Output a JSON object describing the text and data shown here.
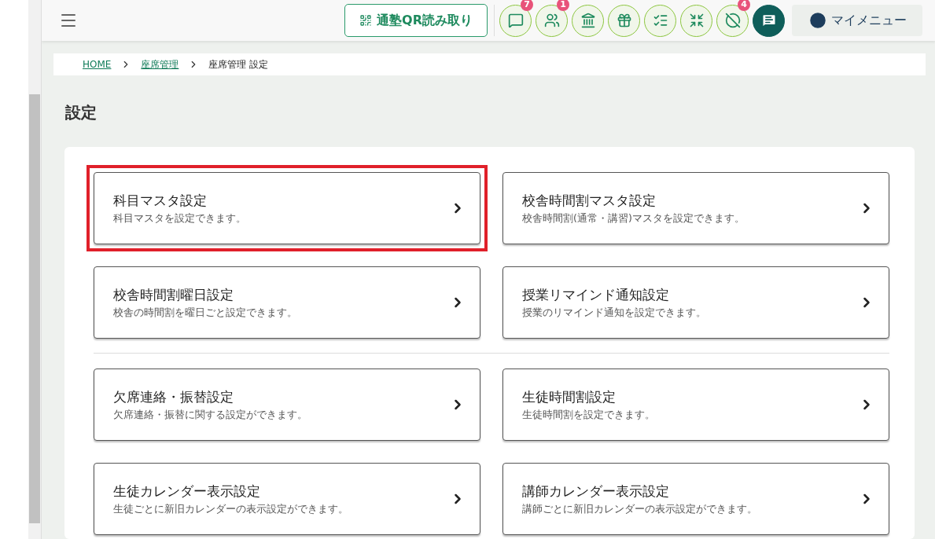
{
  "header": {
    "qr_button": "通塾QR読み取り",
    "icon_buttons": [
      {
        "kind": "chat",
        "badge": "7"
      },
      {
        "kind": "people",
        "badge": "1"
      },
      {
        "kind": "building"
      },
      {
        "kind": "gift"
      },
      {
        "kind": "checklist"
      },
      {
        "kind": "merge"
      },
      {
        "kind": "compass-off",
        "badge": "4"
      },
      {
        "kind": "message-filled"
      }
    ],
    "my_menu": "マイメニュー"
  },
  "breadcrumb": [
    {
      "label": "HOME",
      "link": true
    },
    {
      "label": "座席管理",
      "link": true
    },
    {
      "label": "座席管理 設定",
      "link": false
    }
  ],
  "page_title": "設定",
  "groups": [
    [
      {
        "title": "科目マスタ設定",
        "description": "科目マスタを設定できます。",
        "highlighted": true
      },
      {
        "title": "校舎時間割マスタ設定",
        "description": "校舎時間割(通常・講習)マスタを設定できます。",
        "highlighted": false
      },
      {
        "title": "校舎時間割曜日設定",
        "description": "校舎の時間割を曜日ごと設定できます。",
        "highlighted": false
      },
      {
        "title": "授業リマインド通知設定",
        "description": "授業のリマインド通知を設定できます。",
        "highlighted": false
      }
    ],
    [
      {
        "title": "欠席連絡・振替設定",
        "description": "欠席連絡・振替に関する設定ができます。",
        "highlighted": false
      },
      {
        "title": "生徒時間割設定",
        "description": "生徒時間割を設定できます。",
        "highlighted": false
      },
      {
        "title": "生徒カレンダー表示設定",
        "description": "生徒ごとに新旧カレンダーの表示設定ができます。",
        "highlighted": false
      },
      {
        "title": "講師カレンダー表示設定",
        "description": "講師ごとに新旧カレンダーの表示設定ができます。",
        "highlighted": false
      }
    ]
  ]
}
